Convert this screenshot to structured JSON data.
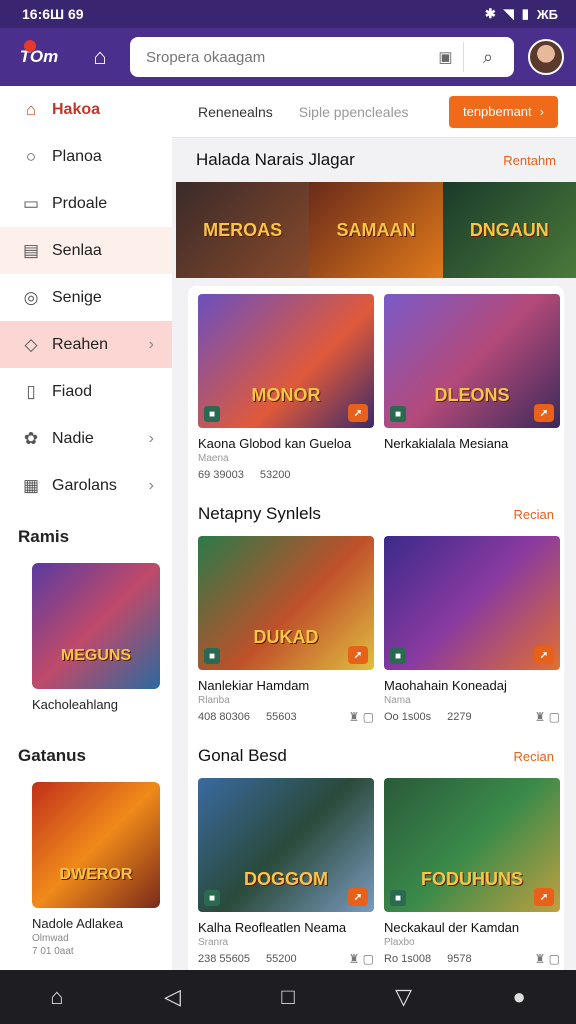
{
  "status": {
    "time": "16:6Ш 69",
    "battery": "ЖБ"
  },
  "appbar": {
    "logo_text": "TOm",
    "search_placeholder": "Sropera okaagam"
  },
  "sidebar": {
    "items": [
      {
        "label": "Hakoa",
        "icon": "home-icon",
        "glyph": "⌂",
        "chevron": false
      },
      {
        "label": "Planoa",
        "icon": "search-icon",
        "glyph": "○",
        "chevron": false
      },
      {
        "label": "Prdoale",
        "icon": "bookmark-icon",
        "glyph": "▭",
        "chevron": false
      },
      {
        "label": "Senlaa",
        "icon": "store-icon",
        "glyph": "▤",
        "chevron": false
      },
      {
        "label": "Senige",
        "icon": "compass-icon",
        "glyph": "◎",
        "chevron": false
      },
      {
        "label": "Reahen",
        "icon": "tag-icon",
        "glyph": "◇",
        "chevron": true
      },
      {
        "label": "Fiaod",
        "icon": "box-icon",
        "glyph": "▯",
        "chevron": false
      },
      {
        "label": "Nadie",
        "icon": "puzzle-icon",
        "glyph": "✿",
        "chevron": true
      },
      {
        "label": "Garolans",
        "icon": "calendar-icon",
        "glyph": "▦",
        "chevron": true
      }
    ],
    "section1": {
      "title": "Ramis",
      "card_text": "MEGUNS",
      "caption": "Kacholeahlang"
    },
    "section2": {
      "title": "Gatanus",
      "card_text": "DWEROR",
      "caption": "Nadole Adlakea",
      "sub1": "Olmwad",
      "sub2": "7 01 0aat"
    }
  },
  "tabs": {
    "tab1": "Renenealns",
    "tab2": "Siple ppencleales",
    "cta": "tenpbemant"
  },
  "banner_section": {
    "title": "Halada Narais Jlagar",
    "link": "Rentahm",
    "items": [
      "MEROAS",
      "SAMAAN",
      "DNGAUN"
    ]
  },
  "panel1": {
    "cards": [
      {
        "art": "MONOR",
        "title": "Kaona Globod kan Gueloa",
        "sub": "Maena",
        "meta1": "69 39003",
        "meta2": "53200"
      },
      {
        "art": "DLEONS",
        "title": "Nerkakialala Mesiana",
        "sub": "",
        "meta1": "",
        "meta2": ""
      }
    ]
  },
  "section2": {
    "title": "Netapny Synlels",
    "link": "Recian",
    "cards": [
      {
        "art": "DUKAD",
        "title": "Nanlekiar Hamdam",
        "sub": "Rlanba",
        "meta1": "408 80306",
        "meta2": "55603"
      },
      {
        "art": "",
        "title": "Maohahain Koneadaj",
        "sub": "Nama",
        "meta1": "Oo 1s00s",
        "meta2": "2279"
      }
    ]
  },
  "section3": {
    "title": "Gonal Besd",
    "link": "Recian",
    "cards": [
      {
        "art": "DOGGOM",
        "title": "Kalha  Reofleatlen Neama",
        "sub": "Sranra",
        "meta1": "238 55605",
        "meta2": "55200"
      },
      {
        "art": "FODUHUNS",
        "title": "Neckakaul der Kamdan",
        "sub": "Plaxbo",
        "meta1": "Ro 1s008",
        "meta2": "9578"
      }
    ]
  },
  "colors": {
    "accent": "#f06a1a",
    "appbar": "#4a2f8c",
    "active": "#c0392b"
  }
}
